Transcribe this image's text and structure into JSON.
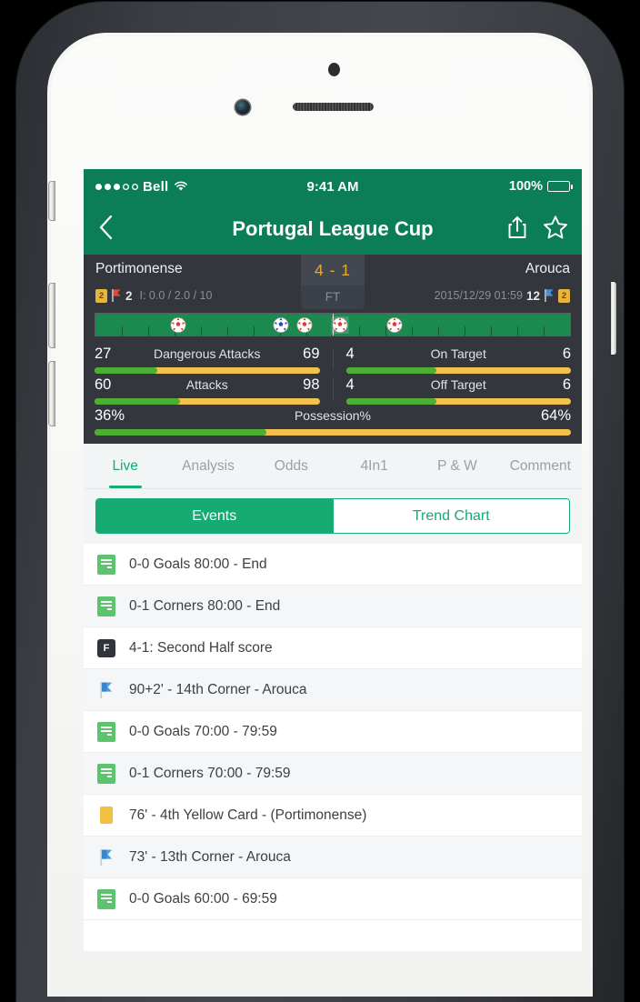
{
  "status_bar": {
    "carrier": "Bell",
    "time": "9:41 AM",
    "battery_percent": "100%",
    "signal_filled": 3,
    "signal_total": 5,
    "wifi_icon": "wifi-icon",
    "battery_icon": "battery-full-icon"
  },
  "nav": {
    "back_icon": "chevron-left-icon",
    "title": "Portugal League Cup",
    "share_icon": "share-icon",
    "favorite_icon": "star-outline-icon"
  },
  "match": {
    "home_team": "Portimonense",
    "away_team": "Arouca",
    "score": "4 - 1",
    "status": "FT",
    "date": "2015/12/29 01:59",
    "home_yellow_cards": "2",
    "home_corners": "2",
    "home_corner_flag_icon": "red-corner-flag-icon",
    "home_extra": "I:  0.0 / 2.0 / 10",
    "away_corners": "12",
    "away_corner_flag_icon": "blue-corner-flag-icon",
    "away_yellow_cards": "2"
  },
  "timeline": {
    "goals": [
      {
        "pos_percent": 17.5,
        "team": "home",
        "second_half": false
      },
      {
        "pos_percent": 39.0,
        "team": "away",
        "second_half": false
      },
      {
        "pos_percent": 44.0,
        "team": "home",
        "second_half": false
      },
      {
        "pos_percent": 51.5,
        "team": "home",
        "second_half": true
      },
      {
        "pos_percent": 63.0,
        "team": "home",
        "second_half": false
      }
    ],
    "halftime_percent": 50
  },
  "stats": [
    {
      "title": "Dangerous Attacks",
      "home": "27",
      "away": "69",
      "home_pct": 28
    },
    {
      "title": "On Target",
      "home": "4",
      "away": "6",
      "home_pct": 40
    },
    {
      "title": "Attacks",
      "home": "60",
      "away": "98",
      "home_pct": 38
    },
    {
      "title": "Off Target",
      "home": "4",
      "away": "6",
      "home_pct": 40
    },
    {
      "title": "Possession%",
      "home": "36%",
      "away": "64%",
      "home_pct": 36
    }
  ],
  "tabs": [
    {
      "label": "Live",
      "active": true
    },
    {
      "label": "Analysis",
      "active": false
    },
    {
      "label": "Odds",
      "active": false
    },
    {
      "label": "4In1",
      "active": false
    },
    {
      "label": "P & W",
      "active": false
    },
    {
      "label": "Comment",
      "active": false
    }
  ],
  "segmented": [
    {
      "label": "Events",
      "active": true
    },
    {
      "label": "Trend Chart",
      "active": false
    }
  ],
  "events": [
    {
      "icon": "note-icon",
      "text": "0-0 Goals 80:00 - End"
    },
    {
      "icon": "note-icon",
      "text": "0-1 Corners 80:00 - End"
    },
    {
      "icon": "fulltime-icon",
      "text": "4-1: Second Half score"
    },
    {
      "icon": "corner-flag-icon",
      "text": "90+2' - 14th Corner - Arouca"
    },
    {
      "icon": "note-icon",
      "text": "0-0 Goals 70:00 - 79:59"
    },
    {
      "icon": "note-icon",
      "text": "0-1 Corners 70:00 - 79:59"
    },
    {
      "icon": "yellow-card-icon",
      "text": "76' - 4th Yellow Card -  (Portimonense)"
    },
    {
      "icon": "corner-flag-icon",
      "text": "73' - 13th Corner - Arouca"
    },
    {
      "icon": "note-icon",
      "text": "0-0 Goals 60:00 - 69:59"
    }
  ],
  "colors": {
    "brand_green": "#0b7e57",
    "accent_green": "#16ab72",
    "score_orange": "#e9a92b",
    "bar_green": "#4cae34",
    "bar_yellow": "#f2c14e",
    "header_dark": "#33363d"
  }
}
